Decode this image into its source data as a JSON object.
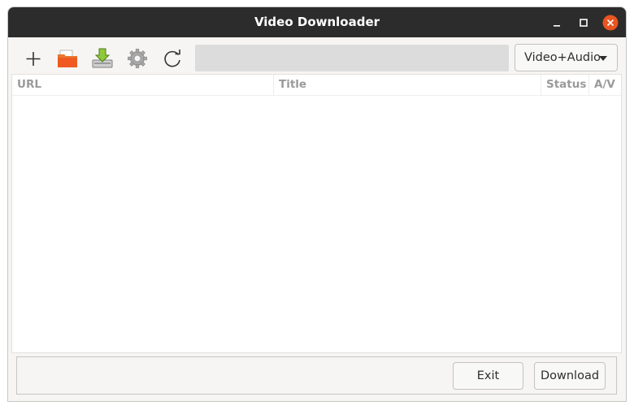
{
  "window": {
    "title": "Video Downloader",
    "controls": [
      "minimize-icon",
      "maximize-icon",
      "close-icon"
    ]
  },
  "toolbar": {
    "tools": [
      "add-icon",
      "open-folder-icon",
      "download-icon",
      "settings-icon",
      "refresh-icon"
    ],
    "url_value": "",
    "mode_selected": "Video+Audio"
  },
  "table": {
    "columns": [
      "URL",
      "Title",
      "Status",
      "A/V"
    ],
    "rows": []
  },
  "footer": {
    "exit_label": "Exit",
    "download_label": "Download"
  },
  "colors": {
    "titlebar": "#2c2c2c",
    "close_button": "#e95420",
    "window_bg": "#f6f5f4"
  }
}
